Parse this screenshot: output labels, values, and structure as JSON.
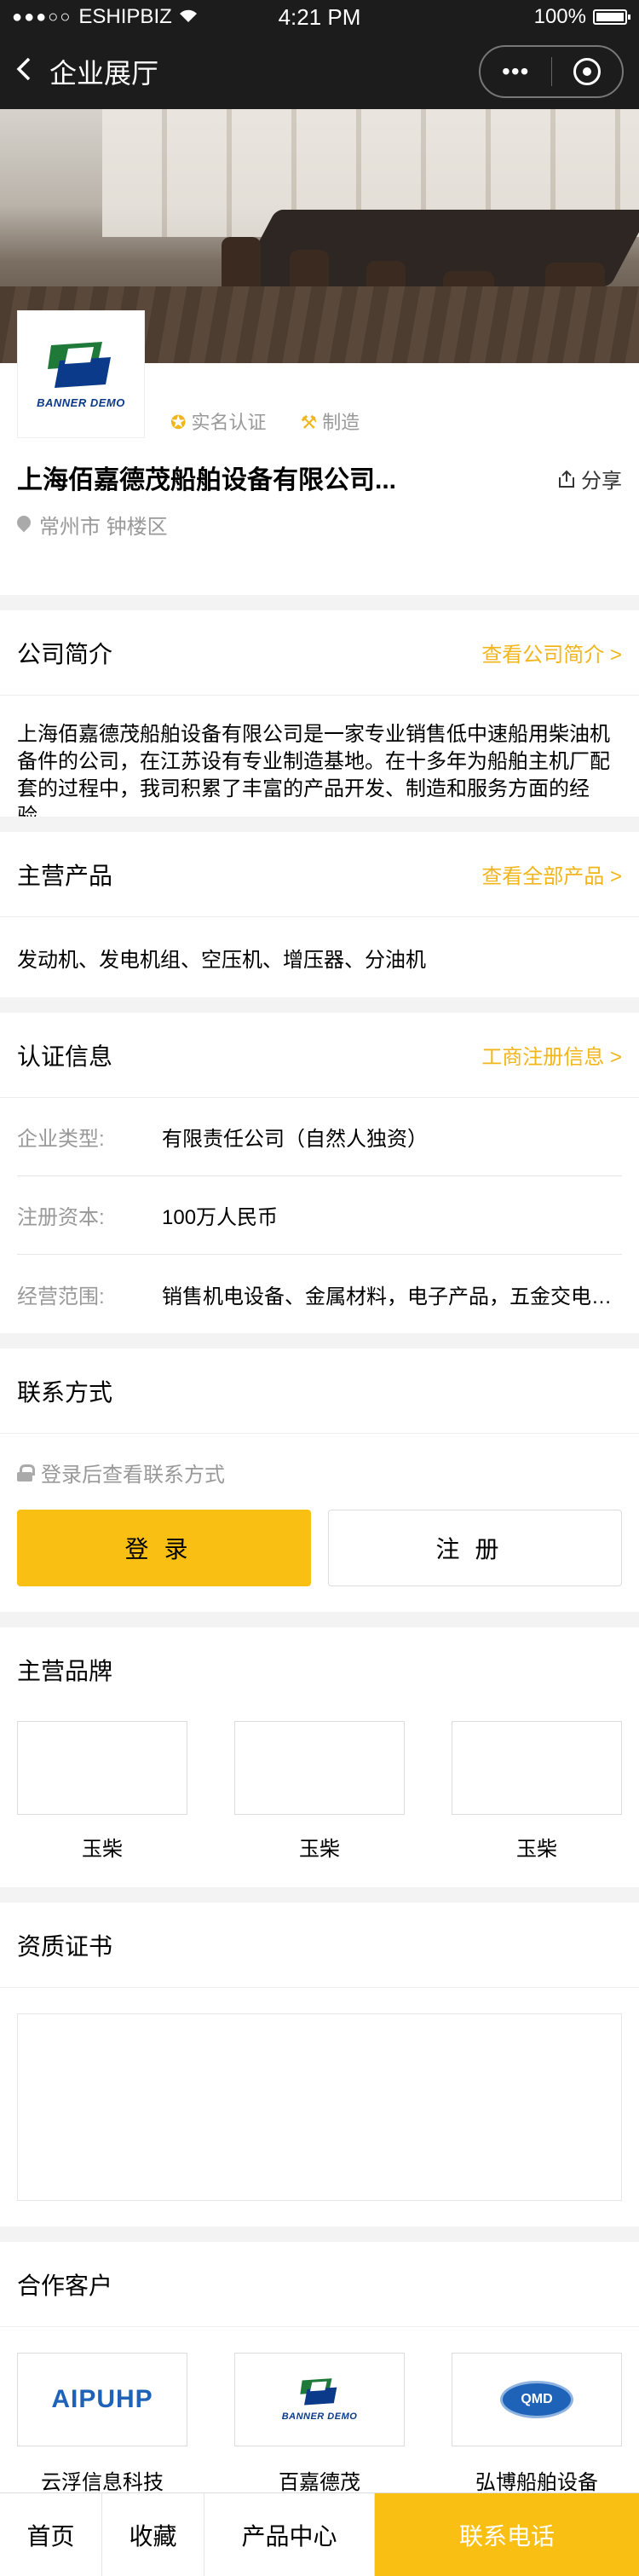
{
  "status": {
    "carrier": "ESHIPBIZ",
    "time": "4:21 PM",
    "battery": "100%"
  },
  "nav": {
    "title": "企业展厅",
    "back_icon": "chevron-left-icon",
    "more_label": "•••"
  },
  "company": {
    "logo_text": "BANNER DEMO",
    "badges": [
      "实名认证",
      "制造"
    ],
    "name": "上海佰嘉德茂船舶设备有限公司...",
    "share": "分享",
    "location": "常州市 钟楼区"
  },
  "intro": {
    "title": "公司简介",
    "more": "查看公司简介 >",
    "text": "上海佰嘉德茂船舶设备有限公司是一家专业销售低中速船用柴油机备件的公司，在江苏设有专业制造基地。在十多年为船舶主机厂配套的过程中，我司积累了丰富的产品开发、制造和服务方面的经验……"
  },
  "products": {
    "title": "主营产品",
    "more": "查看全部产品 >",
    "text": "发动机、发电机组、空压机、增压器、分油机"
  },
  "cert_info": {
    "title": "认证信息",
    "more": "工商注册信息 >",
    "rows": [
      {
        "key": "企业类型:",
        "value": "有限责任公司（自然人独资）"
      },
      {
        "key": "注册资本:",
        "value": "100万人民币"
      },
      {
        "key": "经营范围:",
        "value": "销售机电设备、金属材料，电子产品，五金交电…"
      }
    ]
  },
  "contact": {
    "title": "联系方式",
    "tip": "登录后查看联系方式",
    "login": "登录",
    "register": "注册"
  },
  "brands": {
    "title": "主营品牌",
    "items": [
      "玉柴",
      "玉柴",
      "玉柴"
    ]
  },
  "certs": {
    "title": "资质证书"
  },
  "partners": {
    "title": "合作客户",
    "items": [
      {
        "name": "云浮信息科技",
        "logo": "AIPUHP"
      },
      {
        "name": "百嘉德茂",
        "logo": "BANNER DEMO"
      },
      {
        "name": "弘博船舶设备",
        "logo": "QMD"
      }
    ]
  },
  "tabbar": {
    "home": "首页",
    "fav": "收藏",
    "products": "产品中心",
    "call": "联系电话"
  },
  "colors": {
    "accent": "#fabf13",
    "link": "#f2b51a",
    "divider": "#dcdcdc",
    "topbar": "#1c1c1c"
  }
}
